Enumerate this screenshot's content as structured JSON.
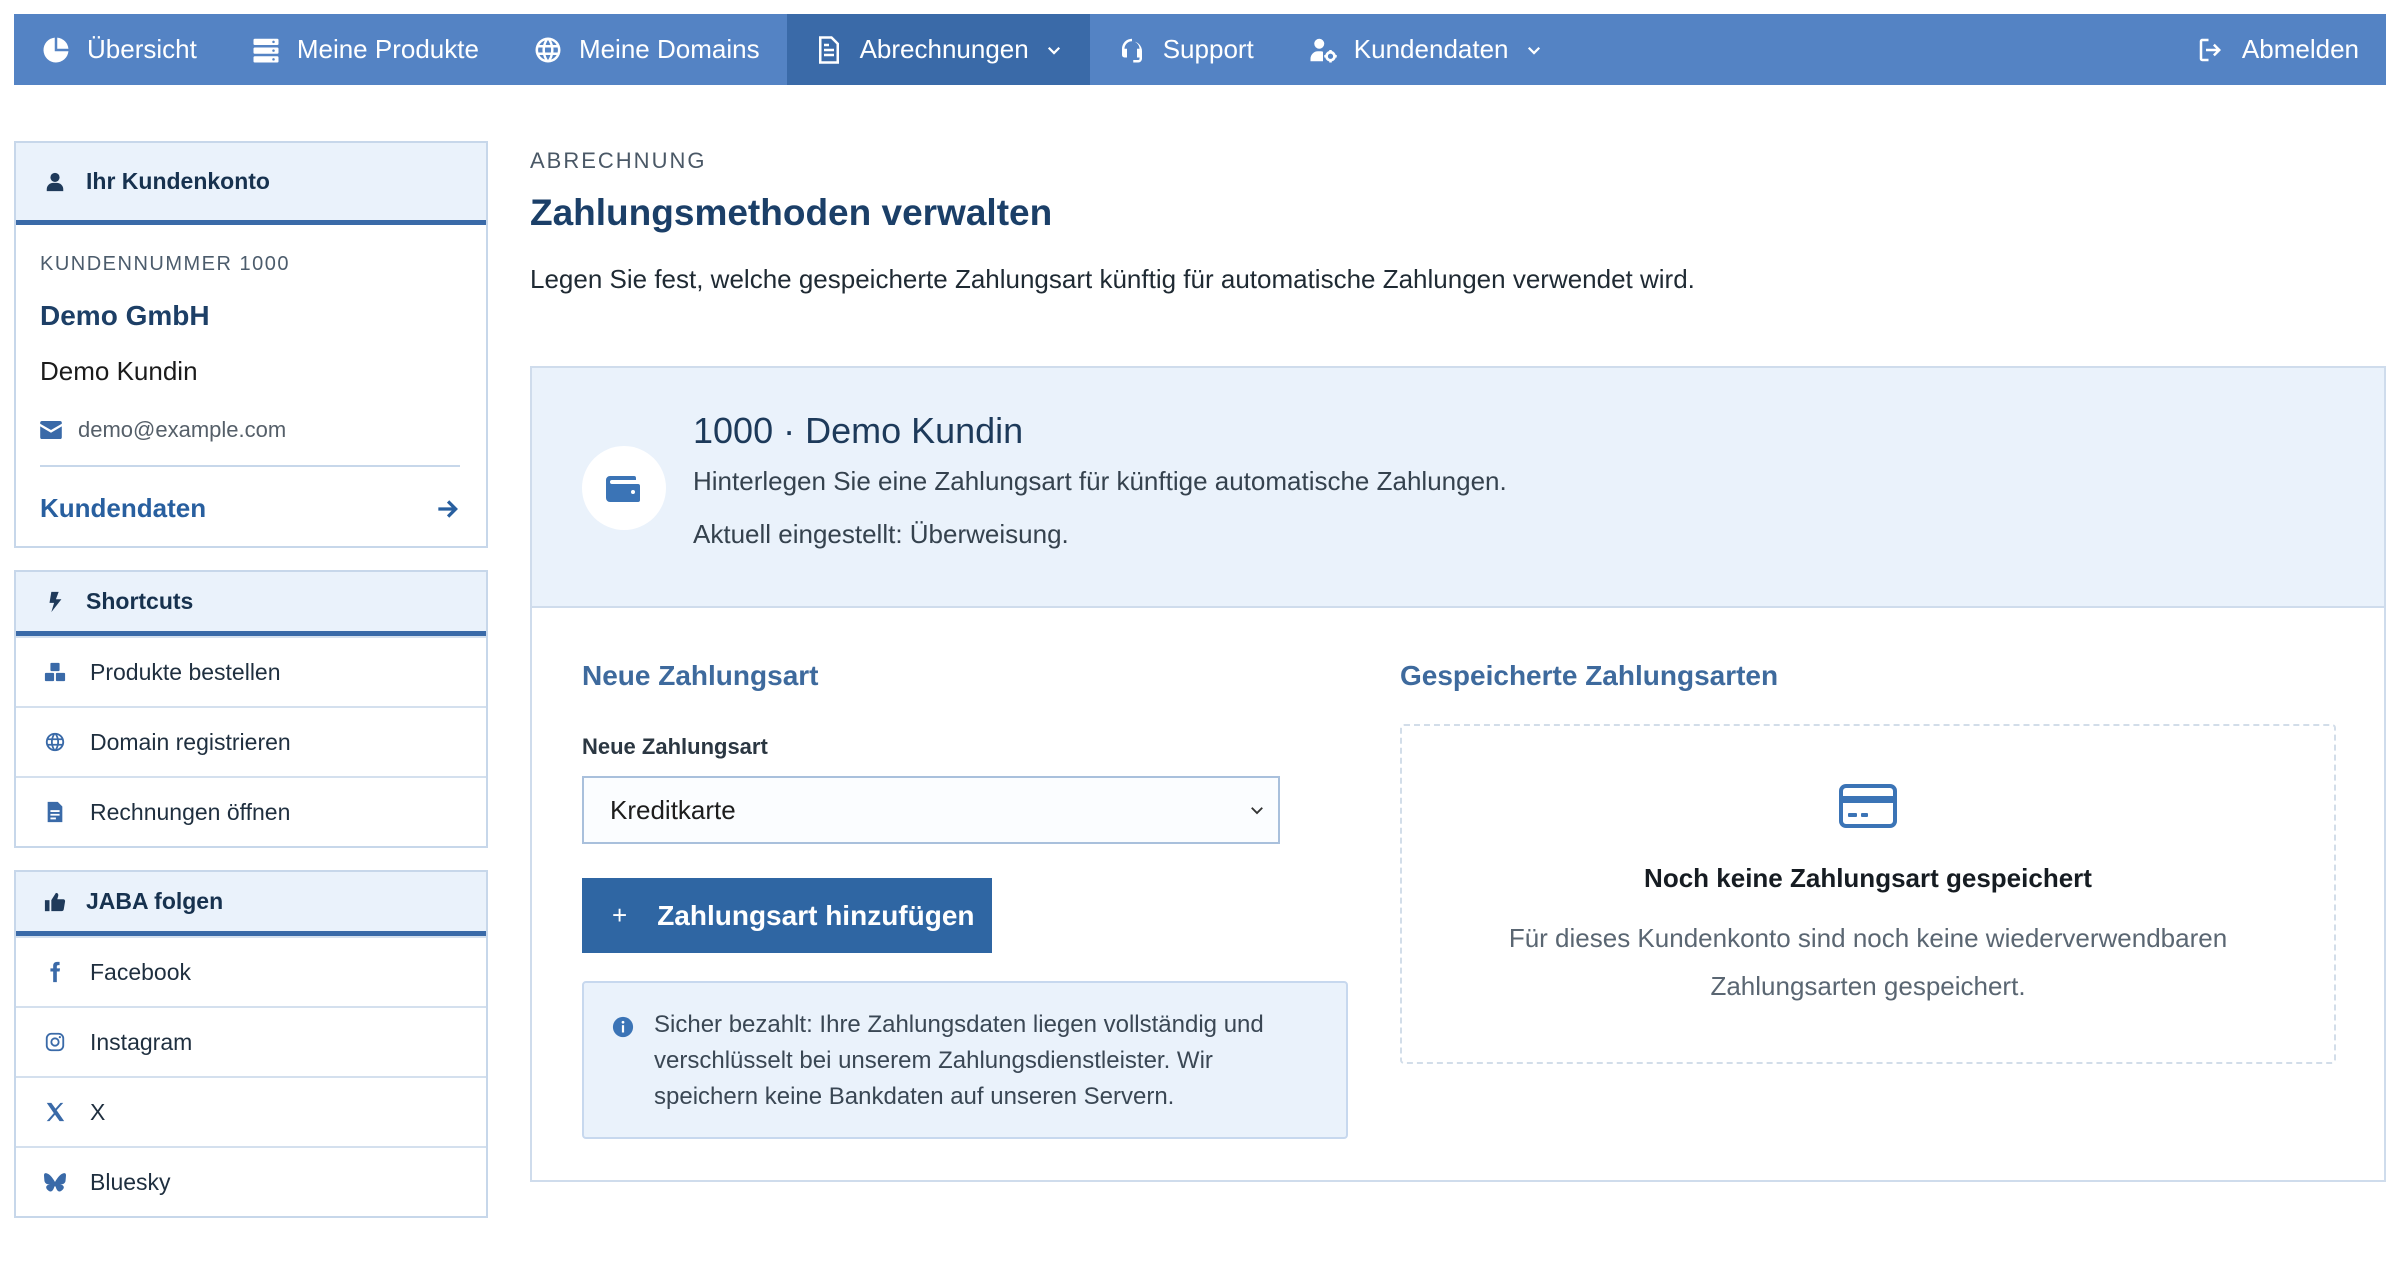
{
  "nav": {
    "items": [
      {
        "label": "Übersicht",
        "icon": "chart-pie-icon"
      },
      {
        "label": "Meine Produkte",
        "icon": "server-icon"
      },
      {
        "label": "Meine Domains",
        "icon": "globe-icon"
      },
      {
        "label": "Abrechnungen",
        "icon": "invoice-icon",
        "active": true,
        "dropdown": true
      },
      {
        "label": "Support",
        "icon": "headset-icon"
      },
      {
        "label": "Kundendaten",
        "icon": "user-gear-icon",
        "dropdown": true
      }
    ],
    "logout": {
      "label": "Abmelden",
      "icon": "logout-icon"
    },
    "colors": {
      "bar": "#5483c4",
      "active": "#3a6aa8"
    }
  },
  "sidebar": {
    "account": {
      "title": "Ihr Kundenkonto",
      "customer_number_label": "KUNDENNUMMER 1000",
      "company": "Demo GmbH",
      "name": "Demo Kundin",
      "email": "demo@example.com",
      "link_label": "Kundendaten"
    },
    "shortcuts": {
      "title": "Shortcuts",
      "items": [
        {
          "label": "Produkte bestellen",
          "icon": "boxes-icon"
        },
        {
          "label": "Domain registrieren",
          "icon": "globe-icon"
        },
        {
          "label": "Rechnungen öffnen",
          "icon": "invoice-icon"
        }
      ]
    },
    "social": {
      "title": "JABA folgen",
      "items": [
        {
          "label": "Facebook",
          "icon": "facebook-icon"
        },
        {
          "label": "Instagram",
          "icon": "instagram-icon"
        },
        {
          "label": "X",
          "icon": "x-icon"
        },
        {
          "label": "Bluesky",
          "icon": "bluesky-icon"
        }
      ]
    }
  },
  "main": {
    "eyebrow": "ABRECHNUNG",
    "title": "Zahlungsmethoden verwalten",
    "intro": "Legen Sie fest, welche gespeicherte Zahlungsart künftig für automatische Zahlungen verwendet wird.",
    "card": {
      "title": "1000 · Demo Kundin",
      "description": "Hinterlegen Sie eine Zahlungsart für künftige automatische Zahlungen.",
      "current": "Aktuell eingestellt: Überweisung.",
      "new_method": {
        "heading": "Neue Zahlungsart",
        "field_label": "Neue Zahlungsart",
        "selected": "Kreditkarte",
        "button_label": "Zahlungsart hinzufügen",
        "button_plus": "+",
        "info": "Sicher bezahlt: Ihre Zahlungsdaten liegen vollständig und verschlüsselt bei unserem Zahlungsdienstleister. Wir speichern keine Bankdaten auf unseren Servern."
      },
      "saved_methods": {
        "heading": "Gespeicherte Zahlungsarten",
        "empty_title": "Noch keine Zahlungsart gespeichert",
        "empty_description": "Für dieses Kundenkonto sind noch keine wiederverwendbaren Zahlungsarten gespeichert."
      }
    },
    "colors": {
      "accent": "#2f66a3",
      "title": "#1b3f68",
      "panel_bg": "#eaf2fb"
    }
  }
}
